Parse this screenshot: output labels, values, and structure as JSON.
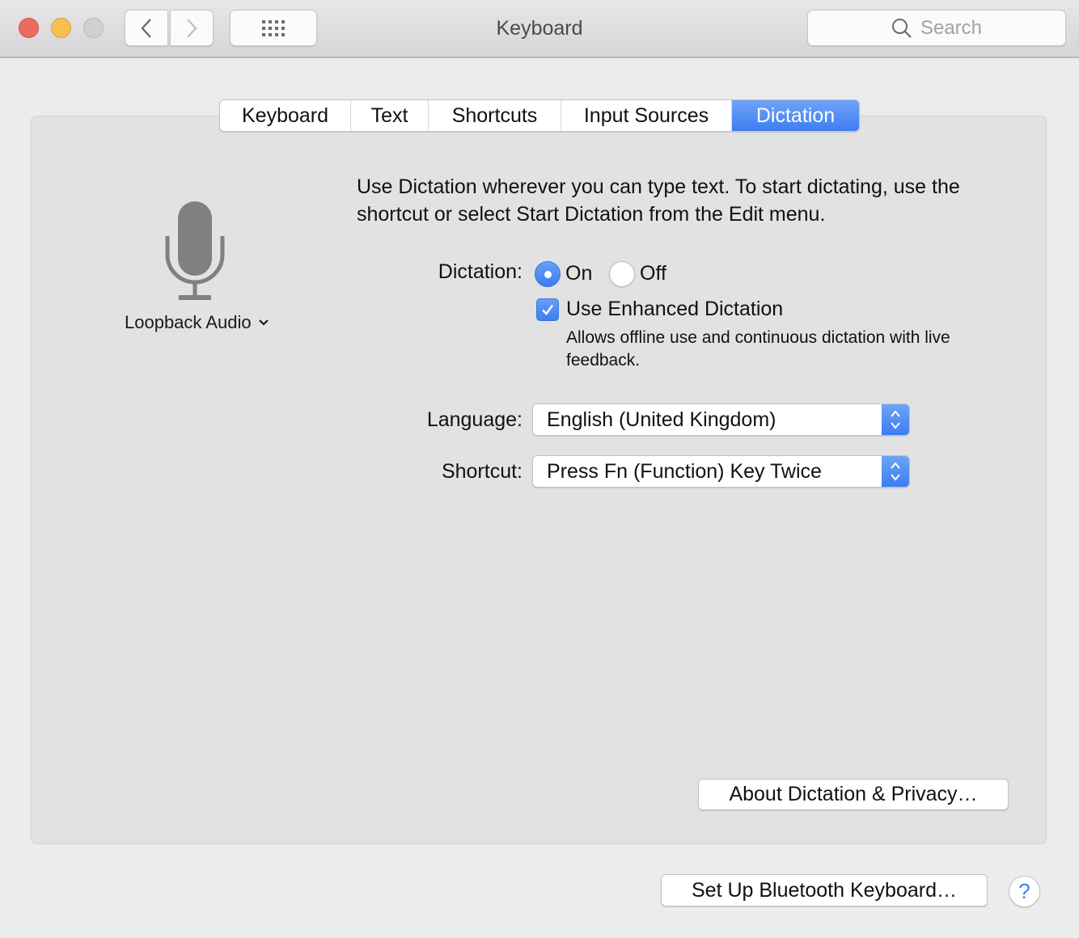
{
  "window": {
    "title": "Keyboard",
    "traffic_lights": [
      "close",
      "minimize",
      "zoom"
    ]
  },
  "toolbar": {
    "back_icon": "chevron-left-icon",
    "forward_icon": "chevron-right-icon",
    "show_all_icon": "grid-icon",
    "search": {
      "placeholder": "Search",
      "value": "",
      "icon": "search-icon"
    }
  },
  "tabs": [
    {
      "label": "Keyboard",
      "active": false
    },
    {
      "label": "Text",
      "active": false
    },
    {
      "label": "Shortcuts",
      "active": false
    },
    {
      "label": "Input Sources",
      "active": false
    },
    {
      "label": "Dictation",
      "active": true
    }
  ],
  "dictation": {
    "microphone_icon": "microphone-icon",
    "mic_source": "Loopback Audio",
    "intro": "Use Dictation wherever you can type text. To start dictating, use the shortcut or select Start Dictation from the Edit menu.",
    "dictation_label": "Dictation:",
    "options": [
      {
        "label": "On",
        "selected": true
      },
      {
        "label": "Off",
        "selected": false
      }
    ],
    "enhanced": {
      "label": "Use Enhanced Dictation",
      "checked": true,
      "description": "Allows offline use and continuous dictation with live feedback."
    },
    "language": {
      "label": "Language:",
      "value": "English (United Kingdom)"
    },
    "shortcut": {
      "label": "Shortcut:",
      "value": "Press Fn (Function) Key Twice"
    },
    "about_button": "About Dictation & Privacy…"
  },
  "footer": {
    "bluetooth_button": "Set Up Bluetooth Keyboard…",
    "help_label": "?"
  },
  "colors": {
    "accent": "#3f7ef1",
    "close": "#ed6a5e",
    "minimize": "#f6c04f",
    "zoom_disabled": "#d0d0d0",
    "panel": "#e2e2e2",
    "window": "#ececec"
  }
}
